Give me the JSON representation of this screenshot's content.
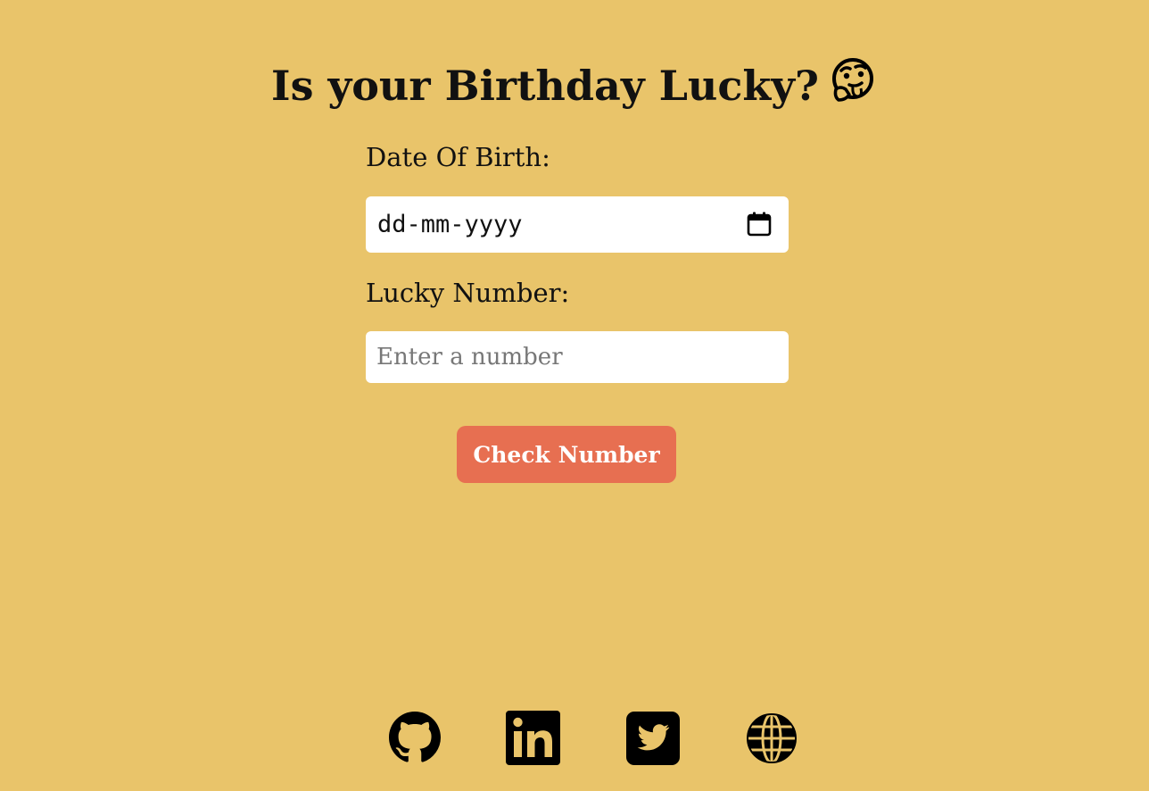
{
  "page": {
    "title": "Is your Birthday Lucky?",
    "title_emoji": "thinking-face-with-tongue-emoji",
    "background_color": "#E9C46A"
  },
  "form": {
    "dob_label": "Date Of Birth:",
    "dob_value": "dd-mm-yyyy",
    "dob_icon": "calendar-icon",
    "lucky_label": "Lucky Number:",
    "lucky_placeholder": "Enter a number",
    "lucky_value": "",
    "check_button_label": "Check Number",
    "button_color": "#E76F51"
  },
  "footer": {
    "links": [
      {
        "icon": "github-icon"
      },
      {
        "icon": "linkedin-icon"
      },
      {
        "icon": "twitter-icon"
      },
      {
        "icon": "globe-icon"
      }
    ]
  }
}
